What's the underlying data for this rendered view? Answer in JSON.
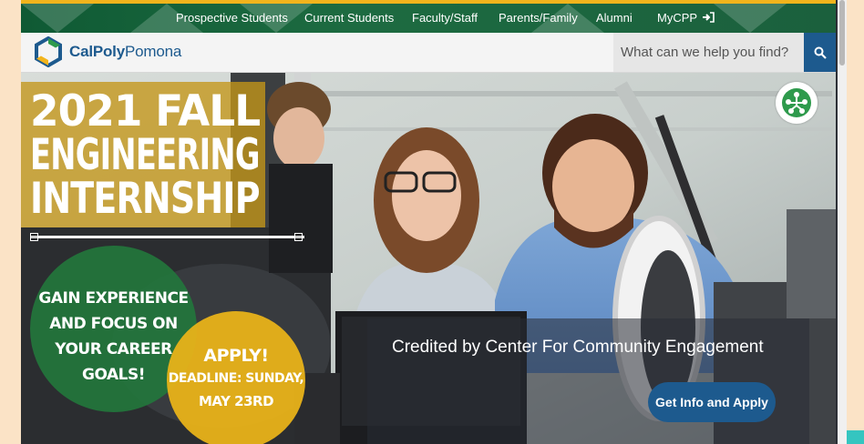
{
  "utility_nav": {
    "items": [
      "Prospective Students",
      "Current Students",
      "Faculty/Staff",
      "Parents/Family",
      "Alumni",
      "MyCPP"
    ]
  },
  "header": {
    "logo_bold": "CalPoly",
    "logo_light": "Pomona",
    "search_placeholder": "What can we help you find?"
  },
  "hero": {
    "headline": [
      "2021 FALL",
      "ENGINEERING",
      "INTERNSHIP"
    ],
    "gain_lines": [
      "GAIN EXPERIENCE",
      "AND FOCUS ON",
      "YOUR CAREER",
      "GOALS!"
    ],
    "apply_lines": [
      "APPLY!",
      "DEADLINE: SUNDAY,",
      "MAY 23RD"
    ],
    "credit": "Credited by Center For Community Engagement",
    "cta_label": "Get Info and Apply"
  },
  "colors": {
    "nav_green": "#1d6b41",
    "gold": "#f2b41c",
    "brand_blue": "#1d5a8e"
  },
  "icons": [
    "login-icon",
    "search-icon",
    "cpp-logo-icon",
    "community-badge-icon"
  ]
}
